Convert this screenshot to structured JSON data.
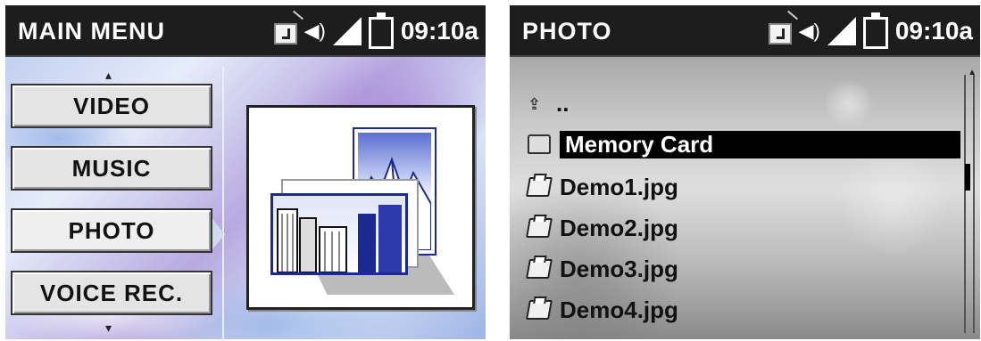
{
  "left": {
    "header": {
      "title": "MAIN MENU",
      "time": "09:10a"
    },
    "menu": {
      "items": [
        {
          "label": "VIDEO"
        },
        {
          "label": "MUSIC"
        },
        {
          "label": "PHOTO",
          "selected": true
        },
        {
          "label": "VOICE REC."
        }
      ],
      "up_arrow": "⁂",
      "down_arrow": "⌄"
    },
    "preview_icon": "photo-gallery-icon"
  },
  "right": {
    "header": {
      "title": "PHOTO",
      "time": "09:10a"
    },
    "list": [
      {
        "label": "..",
        "icon": "up-folder-icon"
      },
      {
        "label": "Memory Card",
        "icon": "folder-icon",
        "selected": true
      },
      {
        "label": "Demo1.jpg",
        "icon": "image-file-icon"
      },
      {
        "label": "Demo2.jpg",
        "icon": "image-file-icon"
      },
      {
        "label": "Demo3.jpg",
        "icon": "image-file-icon"
      },
      {
        "label": "Demo4.jpg",
        "icon": "image-file-icon"
      }
    ]
  },
  "colors": {
    "header_bg": "#1d1d1d",
    "selection_bg": "#000000",
    "accent_blue": "#1b2a8e"
  }
}
